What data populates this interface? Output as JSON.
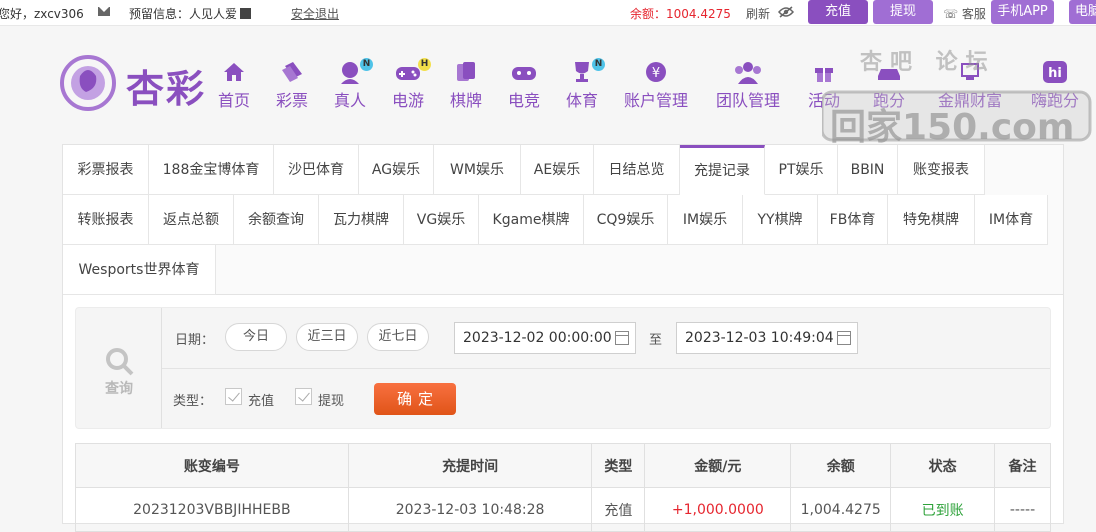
{
  "topbar": {
    "greeting": "您好，zxcv306",
    "reserved_label": "预留信息：人见人爱",
    "logout": "安全退出",
    "balance": "余额：1004.4275",
    "refresh": "刷新",
    "charge": "充值",
    "withdraw": "提现",
    "service": "客服",
    "mobile_app": "手机APP",
    "pc": "电脑"
  },
  "brand": {
    "name": "杏彩"
  },
  "nav": [
    {
      "label": "首页",
      "icon": "home-icon"
    },
    {
      "label": "彩票",
      "icon": "ticket-icon"
    },
    {
      "label": "真人",
      "icon": "dealer-icon",
      "badge": "N"
    },
    {
      "label": "电游",
      "icon": "gamepad-icon",
      "badge": "H"
    },
    {
      "label": "棋牌",
      "icon": "cards-icon"
    },
    {
      "label": "电竞",
      "icon": "controller-icon"
    },
    {
      "label": "体育",
      "icon": "trophy-icon",
      "badge": "N"
    },
    {
      "label": "账户管理",
      "icon": "yen-icon"
    },
    {
      "label": "团队管理",
      "icon": "team-icon"
    },
    {
      "label": "活动",
      "icon": "gift-icon"
    },
    {
      "label": "跑分",
      "icon": "car-icon"
    },
    {
      "label": "金鼎财富",
      "icon": "wealth-icon"
    },
    {
      "label": "嗨跑分",
      "icon": "hi-icon"
    }
  ],
  "watermark": {
    "top": "杏吧  论坛",
    "bottom": "回家150.com"
  },
  "tabs_row1": [
    "彩票报表",
    "188金宝博体育",
    "沙巴体育",
    "AG娱乐",
    "WM娱乐",
    "AE娱乐",
    "日结总览",
    "充提记录",
    "PT娱乐",
    "BBIN",
    "账变报表"
  ],
  "tabs_row2": [
    "转账报表",
    "返点总额",
    "余额查询",
    "瓦力棋牌",
    "VG娱乐",
    "Kgame棋牌",
    "CQ9娱乐",
    "IM娱乐",
    "YY棋牌",
    "FB体育",
    "特免棋牌",
    "IM体育"
  ],
  "tabs_row3": [
    "Wesports世界体育"
  ],
  "filter": {
    "query_label": "查询",
    "date_label": "日期：",
    "today": "今日",
    "three_days": "近三日",
    "seven_days": "近七日",
    "start": "2023-12-02 00:00:00",
    "to": "至",
    "end": "2023-12-03 10:49:04",
    "type_label": "类型：",
    "type_charge": "充值",
    "type_withdraw": "提现",
    "confirm": "确定"
  },
  "table": {
    "headers": [
      "账变编号",
      "充提时间",
      "类型",
      "金额/元",
      "余额",
      "状态",
      "备注"
    ],
    "rows": [
      [
        "20231203VBBJIHHEBB",
        "2023-12-03 10:48:28",
        "充值",
        "+1,000.0000",
        "1,004.4275",
        "已到账",
        "-----"
      ]
    ]
  },
  "colors": {
    "brand": "#8a4fbf",
    "accent": "#e05418",
    "positive": "#e6262f",
    "success": "#2ea23a"
  }
}
